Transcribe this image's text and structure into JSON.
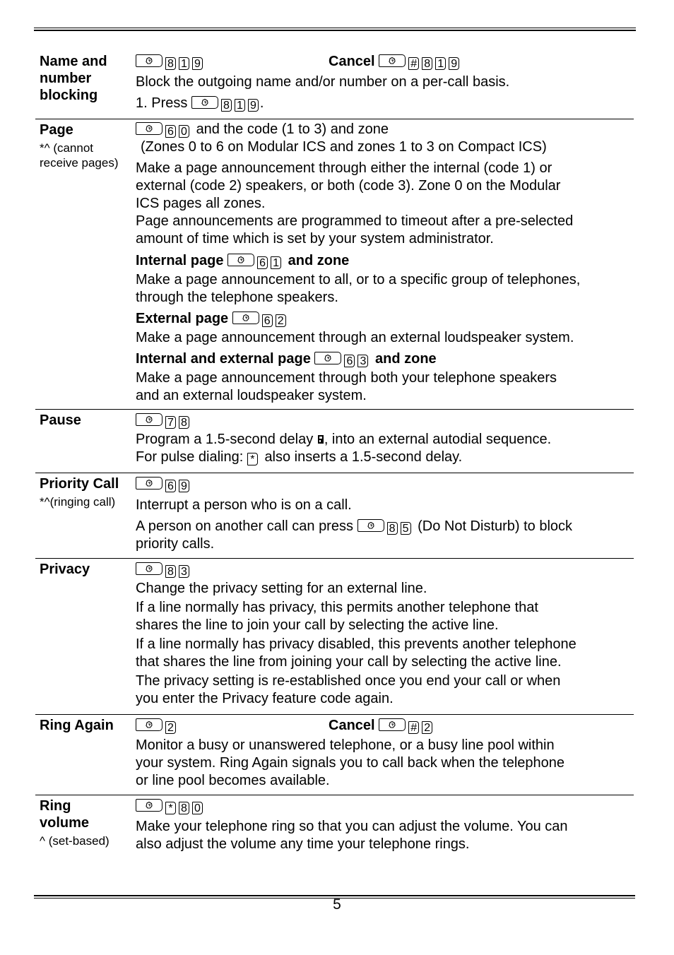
{
  "page": {
    "number": "5"
  },
  "icons": {
    "feature_key": "feature-key-icon",
    "pause": "pause-symbol-icon"
  },
  "rows": [
    {
      "term": [
        "Name and",
        "number",
        "blocking"
      ],
      "note": [],
      "code": [
        "8",
        "1",
        "9"
      ],
      "cancel": {
        "label": "Cancel",
        "keys": [
          "#",
          "8",
          "1",
          "9"
        ]
      },
      "desc": "Block the outgoing name and/or number on a per-call basis.",
      "step": {
        "prefix": "1. Press",
        "keys": [
          "8",
          "1",
          "9"
        ],
        "suffix": "."
      }
    },
    {
      "term": [
        "Page"
      ],
      "note": [
        "*^ (cannot",
        "receive pages)"
      ],
      "code": [
        "6",
        "0"
      ],
      "code_suffix": "and the code (1 to 3) and zone",
      "zones_note": "(Zones 0 to 6 on Modular ICS and zones 1 to 3 on Compact ICS)",
      "desc_lines": [
        "Make a page announcement through either the internal (code 1) or",
        "external (code 2) speakers, or both (code 3). Zone 0 on the Modular",
        "ICS pages all zones.",
        "Page announcements are programmed to timeout after a pre-selected",
        "amount of time which is set by your system administrator."
      ],
      "subs": [
        {
          "title": "Internal page",
          "keys": [
            "6",
            "1"
          ],
          "suffix": "and zone",
          "lines": [
            "Make a page announcement to all, or to a specific group of telephones,",
            "through the telephone speakers."
          ]
        },
        {
          "title": "External page",
          "keys": [
            "6",
            "2"
          ],
          "suffix": "",
          "lines": [
            "Make a page announcement through an external loudspeaker system."
          ]
        },
        {
          "title": "Internal and external page",
          "keys": [
            "6",
            "3"
          ],
          "suffix": "and zone",
          "lines": [
            "Make a page announcement through both your telephone speakers",
            "and an external loudspeaker system."
          ]
        }
      ]
    },
    {
      "term": [
        "Pause"
      ],
      "note": [],
      "code": [
        "7",
        "8"
      ],
      "line1_before": "Program a 1.5-second delay",
      "line1_after": ", into an external autodial sequence.",
      "line2_before": "For pulse dialing:",
      "line2_key": "*",
      "line2_after": "also inserts a 1.5-second delay."
    },
    {
      "term": [
        "Priority Call"
      ],
      "note": [
        "*^(ringing call)"
      ],
      "code": [
        "6",
        "9"
      ],
      "desc": "Interrupt a person who is on a call.",
      "dnd_before": "A person on another call can press",
      "dnd_keys": [
        "8",
        "5"
      ],
      "dnd_after": "(Do Not Disturb) to block",
      "dnd_line2": "priority calls."
    },
    {
      "term": [
        "Privacy"
      ],
      "note": [],
      "code": [
        "8",
        "3"
      ],
      "paras": [
        [
          "Change the privacy setting for an external line."
        ],
        [
          "If a line normally has privacy, this permits another telephone that",
          "shares the line to join your call by selecting the active line."
        ],
        [
          "If a line normally has privacy disabled, this prevents another telephone",
          "that shares the line from joining your call by selecting the active line."
        ],
        [
          "The privacy setting is re-established once you end your call or when",
          "you enter the Privacy feature code again."
        ]
      ]
    },
    {
      "term": [
        "Ring Again"
      ],
      "note": [],
      "code": [
        "2"
      ],
      "cancel": {
        "label": "Cancel",
        "keys": [
          "#",
          "2"
        ]
      },
      "lines": [
        "Monitor a busy or unanswered telephone, or a busy line pool within",
        "your system. Ring Again signals you to call back when the telephone",
        "or line pool becomes available."
      ]
    },
    {
      "term": [
        "Ring",
        "volume"
      ],
      "note": [
        "^ (set-based)"
      ],
      "code": [
        "*",
        "8",
        "0"
      ],
      "lines": [
        "Make your telephone ring so that you can adjust the volume. You can",
        "also adjust the volume any time your telephone rings."
      ]
    }
  ]
}
